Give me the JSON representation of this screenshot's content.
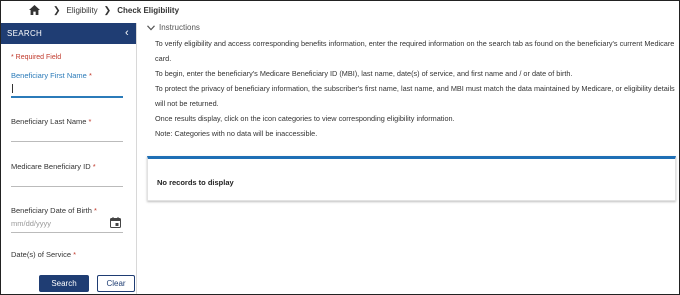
{
  "breadcrumb": {
    "items": [
      "Eligibility",
      "Check Eligibility"
    ]
  },
  "sidebar": {
    "title": "SEARCH",
    "required_note": "* Required Field",
    "fields": {
      "first_name": {
        "label": "Beneficiary First Name",
        "required": "*"
      },
      "last_name": {
        "label": "Beneficiary Last Name",
        "required": "*"
      },
      "mbi": {
        "label": "Medicare Beneficiary ID",
        "required": "*"
      },
      "dob": {
        "label": "Beneficiary Date of Birth",
        "required": "*",
        "placeholder": "mm/dd/yyyy"
      },
      "dos": {
        "label": "Date(s) of Service",
        "required": "*"
      }
    },
    "search_label": "Search",
    "clear_label": "Clear"
  },
  "main": {
    "instructions_title": "Instructions",
    "paragraphs": [
      "To verify eligibility and access corresponding benefits information, enter the required information on the search tab as found on the beneficiary's current Medicare card.",
      "To begin, enter the beneficiary's Medicare Beneficiary ID (MBI), last name, date(s) of service, and first name and / or date of birth.",
      "To protect the privacy of beneficiary information, the subscriber's first name, last name, and MBI must match the data maintained by Medicare, or eligibility details will not be returned.",
      "Once results display, click on the icon categories to view corresponding eligibility information.",
      "Note: Categories with no data will be inaccessible."
    ],
    "no_records": "No records to display"
  },
  "colors": {
    "primary": "#1f3d73",
    "accent_blue": "#2b7bb9",
    "required_red": "#c0392b",
    "records_bar": "#1f6fb5"
  }
}
